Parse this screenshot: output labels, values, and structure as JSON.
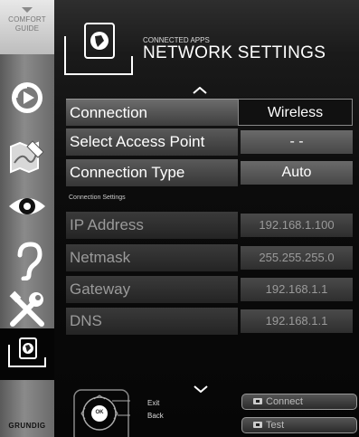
{
  "sidebar": {
    "guide_line1": "COMFORT",
    "guide_line2": "GUIDE",
    "items": [
      {
        "name": "media-icon",
        "active": false
      },
      {
        "name": "map-edit-icon",
        "active": false
      },
      {
        "name": "eye-icon",
        "active": false
      },
      {
        "name": "hearing-icon",
        "active": false
      },
      {
        "name": "tools-icon",
        "active": false
      },
      {
        "name": "connected-apps-icon",
        "active": true
      }
    ],
    "brand": "GRUNDIG"
  },
  "header": {
    "subtitle": "CONNECTED APPS",
    "title": "NETWORK SETTINGS",
    "icon": "globe-icon"
  },
  "settings": {
    "connection": {
      "label": "Connection",
      "value": "Wireless"
    },
    "access_point": {
      "label": "Select Access Point",
      "value": "- -"
    },
    "connection_type": {
      "label": "Connection Type",
      "value": "Auto"
    },
    "section_label": "Connection Settings",
    "ip_address": {
      "label": "IP Address",
      "value": "192.168.1.100"
    },
    "netmask": {
      "label": "Netmask",
      "value": "255.255.255.0"
    },
    "gateway": {
      "label": "Gateway",
      "value": "192.168.1.1"
    },
    "dns": {
      "label": "DNS",
      "value": "192.168.1.1"
    }
  },
  "footer": {
    "ok_label": "OK",
    "exit_label": "Exit",
    "back_label": "Back",
    "connect_label": "Connect",
    "test_label": "Test"
  },
  "colors": {
    "sidebar_bg": "#8a8a8a",
    "panel_bg": "#0c0c0c",
    "text": "#ffffff",
    "dim_text": "#9a9a9a"
  }
}
